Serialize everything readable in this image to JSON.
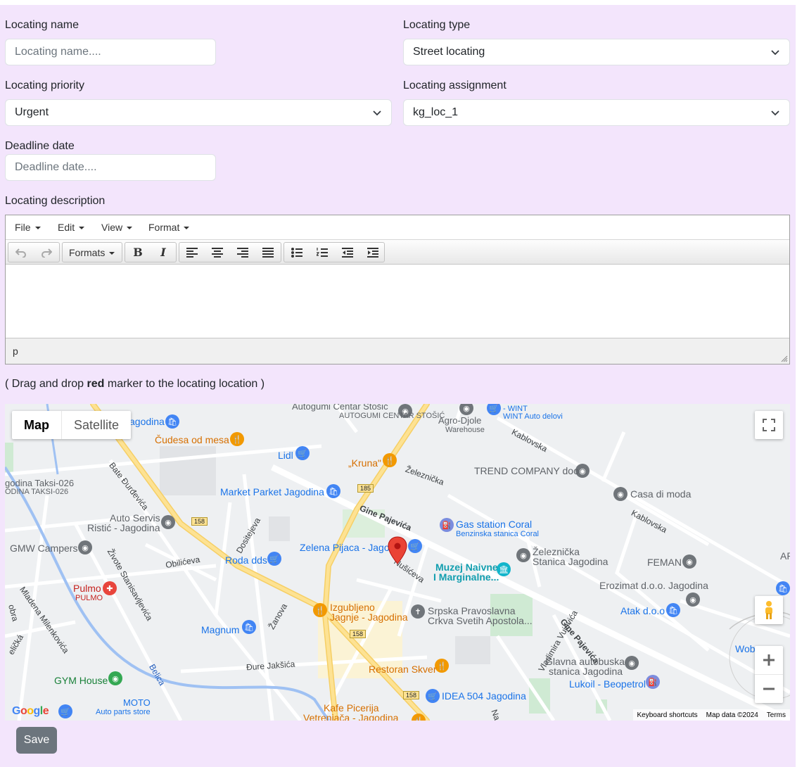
{
  "form": {
    "name_label": "Locating name",
    "name_placeholder": "Locating name....",
    "type_label": "Locating type",
    "type_value": "Street locating",
    "priority_label": "Locating priority",
    "priority_value": "Urgent",
    "assignment_label": "Locating assignment",
    "assignment_value": "kg_loc_1",
    "deadline_label": "Deadline date",
    "deadline_placeholder": "Deadline date....",
    "description_label": "Locating description"
  },
  "editor": {
    "menu": [
      "File",
      "Edit",
      "View",
      "Format"
    ],
    "formats_label": "Formats",
    "toolbar_icons": [
      "undo-icon",
      "redo-icon",
      "bold-icon",
      "italic-icon",
      "align-left-icon",
      "align-center-icon",
      "align-right-icon",
      "align-justify-icon",
      "bullet-list-icon",
      "numbered-list-icon",
      "outdent-icon",
      "indent-icon"
    ],
    "status_path": "p"
  },
  "instruction": {
    "before": "( Drag and drop ",
    "bold": "red",
    "after": " marker to the locating location )"
  },
  "map": {
    "toggle_map": "Map",
    "toggle_satellite": "Satellite",
    "labels": {
      "autogumi": "Autogumi Centar Stošić",
      "autogumi_sub": "AUTOGUMI CENTAR STOŠIĆ",
      "agro": "Agro-Djole",
      "agro_sub": "Warehouse",
      "wint": "- WINT",
      "wint_sub": "WINT Auto delovi",
      "jagodina": "agodina",
      "cudesa": "Čudesa od mesa",
      "lidl": "Lidl",
      "kruna": "„Kruna\"",
      "trend": "TREND COMPANY doo",
      "casa": "Casa di moda",
      "taksi": "godina Taksi-026",
      "taksi_sub": "ODINA TAKSI-026",
      "market": "Market Parket Jagodina",
      "auto_servis": "Auto Servis",
      "auto_servis2": "Ristić - Jagodina",
      "gas": "Gas station Coral",
      "gas_sub": "Benzinska stanica Coral",
      "gmw": "GMW Campers",
      "zelena": "Zelena Pijaca - Jago",
      "zeleznicka": "Železnička",
      "zeleznicka2": "Stanica Jagodina",
      "feman": "FEMAN",
      "roda": "Roda dds",
      "muzej": "Muzej Naivne",
      "muzej2": "I Marginalne...",
      "erozimat": "Erozimat d.o.o. Jagodina",
      "pulmo": "Pulmo",
      "pulmo_sub": "PULMO",
      "izgubljeno": "Izgubljeno",
      "izgubljeno2": "Jagnje - Jagodina",
      "srpska": "Srpska Pravoslavna",
      "srpska2": "Crkva Svetih Apostola...",
      "atak": "Atak d.o.o",
      "magnum": "Magnum",
      "restoran": "Restoran Skver",
      "glavna": "Glavna autobuska",
      "glavna2": "stanica Jagodina",
      "lukoil": "Lukoil - Beopetrol",
      "gym": "GYM House",
      "moto": "MOTO",
      "moto_sub": "Auto parts store",
      "idea": "IDEA 504 Jagodina",
      "kafe": "Kafe Picerija",
      "vetrenjaca": "Vetrenjača - Jagodina",
      "ap": "AP",
      "wob": "Wob"
    },
    "streets": {
      "zeleznicka_st": "Železnička",
      "kablovska1": "Kablovska",
      "kablovska2": "Kablovska",
      "gine1": "Gine Pajevića",
      "gine2": "Gine Pajevića",
      "bate": "Bate Đurđevića",
      "dositejeva": "Dositejeva",
      "zivote": "Živote Stanisavljevića",
      "obiliceva": "Obilićeva",
      "nusiceva": "Nušićeva",
      "mladena": "Mladena Milenkovića",
      "zanova": "Žanova",
      "dure": "Đure Jakšića",
      "belica": "Belica",
      "vladimira": "Vladimira Vujovića",
      "obra": "obra",
      "elicka": "eličká",
      "na": "Na"
    },
    "shields": [
      "185",
      "158",
      "158",
      "158"
    ],
    "google": "Google",
    "keyboard": "Keyboard shortcuts",
    "map_data": "Map data ©2024",
    "terms": "Terms"
  },
  "save_label": "Save"
}
